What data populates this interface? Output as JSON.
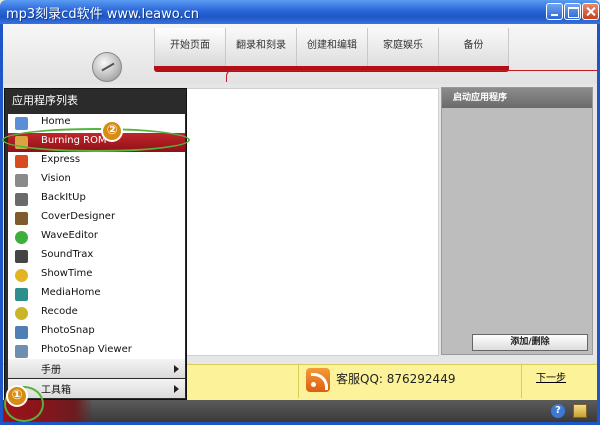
{
  "window": {
    "title": "mp3刻录cd软件 www.leawo.cn"
  },
  "tabs": [
    {
      "label": "开始页面"
    },
    {
      "label": "翻录和刻录"
    },
    {
      "label": "创建和编辑"
    },
    {
      "label": "家庭娱乐"
    },
    {
      "label": "备份"
    }
  ],
  "menu": {
    "title": "应用程序列表",
    "items": [
      {
        "label": "Home",
        "icon": "home-icon",
        "color": "#5a8fd8"
      },
      {
        "label": "Burning ROM",
        "icon": "burning-rom-icon",
        "color": "#d9a441",
        "selected": true
      },
      {
        "label": "Express",
        "icon": "express-icon",
        "color": "#d84a1f"
      },
      {
        "label": "Vision",
        "icon": "vision-icon",
        "color": "#8a8a8a"
      },
      {
        "label": "BackItUp",
        "icon": "backitup-icon",
        "color": "#6a6a6a"
      },
      {
        "label": "CoverDesigner",
        "icon": "coverdesigner-icon",
        "color": "#7f5a2a"
      },
      {
        "label": "WaveEditor",
        "icon": "waveeditor-icon",
        "color": "#3eae3e"
      },
      {
        "label": "SoundTrax",
        "icon": "soundtrax-icon",
        "color": "#444444"
      },
      {
        "label": "ShowTime",
        "icon": "showtime-icon",
        "color": "#e0b521"
      },
      {
        "label": "MediaHome",
        "icon": "mediahome-icon",
        "color": "#2e8e8e"
      },
      {
        "label": "Recode",
        "icon": "recode-icon",
        "color": "#c9b42a"
      },
      {
        "label": "PhotoSnap",
        "icon": "photosnap-icon",
        "color": "#4f7fb5"
      },
      {
        "label": "PhotoSnap Viewer",
        "icon": "photosnap-viewer-icon",
        "color": "#6f8fb0"
      }
    ],
    "submenus": [
      {
        "label": "手册"
      },
      {
        "label": "工具箱"
      }
    ]
  },
  "right_panel": {
    "title": "启动应用程序",
    "button": "添加/删除"
  },
  "footer": {
    "qq_text": "客服QQ: 876292449",
    "next_link": "下一步"
  },
  "annotations": {
    "step1": "①",
    "step2": "②"
  },
  "colors": {
    "accent_red": "#b20f17",
    "annotation_green": "#57b33c",
    "annotation_orange": "#d88b15",
    "footer_yellow": "#fbf299"
  }
}
